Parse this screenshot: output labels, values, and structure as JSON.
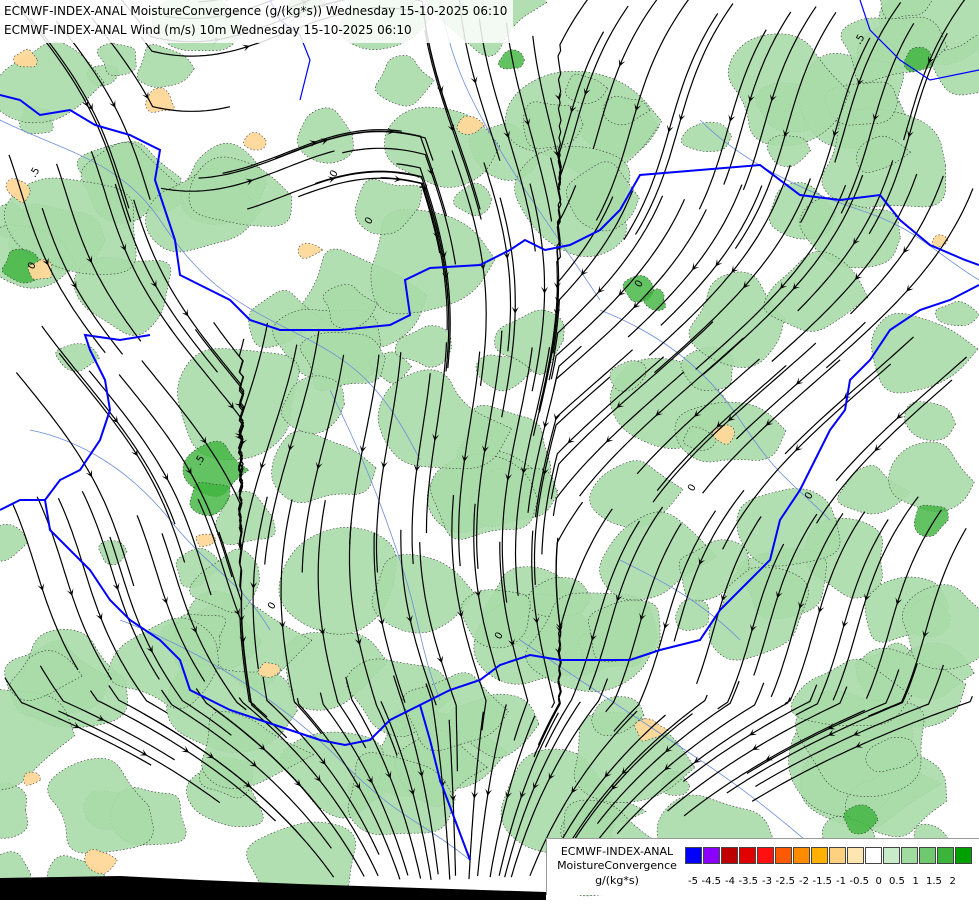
{
  "titles": {
    "line1": "ECMWF-INDEX-ANAL MoistureConvergence (g/(kg*s)) Wednesday 15-10-2025 06:10",
    "line2": "ECMWF-INDEX-ANAL Wind (m/s) 10m Wednesday 15-10-2025 06:10"
  },
  "contour_labels": [
    "0",
    "0",
    "0",
    "0",
    ".5",
    "0",
    "0",
    ".5",
    ".5",
    "0",
    "0"
  ],
  "legend": {
    "model": "ECMWF-INDEX-ANAL",
    "field": "MoistureConvergence",
    "units": "g/(kg*s)",
    "colors": [
      "#0000ff",
      "#8b00ff",
      "#c00000",
      "#e00000",
      "#ff1010",
      "#ff5a00",
      "#ff8c00",
      "#ffb000",
      "#ffd080",
      "#ffe6b0",
      "#ffffff",
      "#c8ebc8",
      "#a0dca0",
      "#70c870",
      "#3cb43c",
      "#00a000"
    ],
    "ticks": [
      "-5",
      "-4.5",
      "-4",
      "-3.5",
      "-3",
      "-2.5",
      "-2",
      "-1.5",
      "-1",
      "-0.5",
      "0",
      "0.5",
      "1",
      "1.5",
      "2"
    ]
  },
  "colors": {
    "positive_fill": "#a8dba8",
    "strong_positive_fill": "#3cb43c",
    "negative_fill": "#ffd89a",
    "border": "#0000ff",
    "rivers": "#6d8ed8",
    "streamlines": "#000000"
  }
}
